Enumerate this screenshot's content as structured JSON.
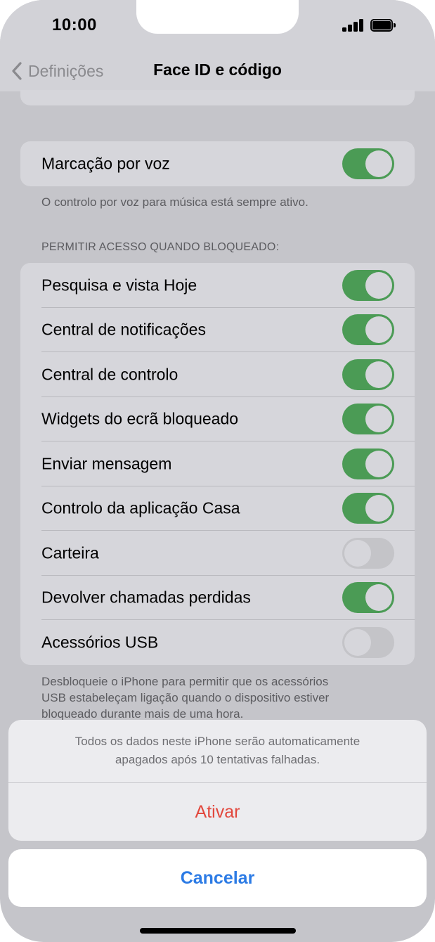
{
  "status_bar": {
    "time": "10:00"
  },
  "nav": {
    "back_label": "Definições",
    "title": "Face ID e código"
  },
  "voice_dial": {
    "label": "Marcação por voz",
    "on": true,
    "footer": "O controlo por voz para música está sempre ativo."
  },
  "locked_access": {
    "header": "PERMITIR ACESSO QUANDO BLOQUEADO:",
    "items": [
      {
        "label": "Pesquisa e vista Hoje",
        "on": true
      },
      {
        "label": "Central de notificações",
        "on": true
      },
      {
        "label": "Central de controlo",
        "on": true
      },
      {
        "label": "Widgets do ecrã bloqueado",
        "on": true
      },
      {
        "label": "Enviar mensagem",
        "on": true
      },
      {
        "label": "Controlo da aplicação Casa",
        "on": true
      },
      {
        "label": "Carteira",
        "on": false
      },
      {
        "label": "Devolver chamadas perdidas",
        "on": true
      },
      {
        "label": "Acessórios USB",
        "on": false
      }
    ],
    "footer_lines": [
      "Desbloqueie o iPhone para permitir que os acessórios",
      "USB estabeleçam ligação quando o dispositivo estiver",
      "bloqueado durante mais de uma hora."
    ]
  },
  "action_sheet": {
    "message_lines": [
      "Todos os dados neste iPhone serão automaticamente",
      "apagados após 10 tentativas falhadas."
    ],
    "destructive_label": "Ativar",
    "cancel_label": "Cancelar"
  },
  "colors": {
    "toggle_on": "#4b9b55",
    "destructive": "#e2483d",
    "link": "#2c7be5"
  }
}
